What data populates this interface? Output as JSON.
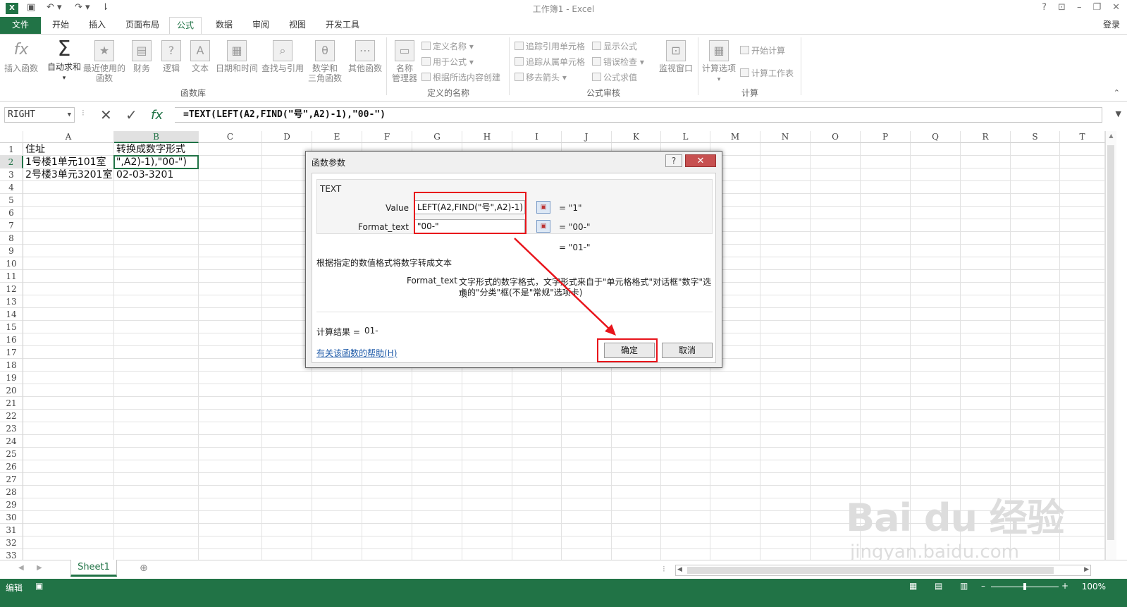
{
  "window": {
    "title": "工作簿1 - Excel",
    "help": "?",
    "login": "登录"
  },
  "tabs": [
    {
      "label": "文件"
    },
    {
      "label": "开始"
    },
    {
      "label": "插入"
    },
    {
      "label": "页面布局"
    },
    {
      "label": "公式"
    },
    {
      "label": "数据"
    },
    {
      "label": "审阅"
    },
    {
      "label": "视图"
    },
    {
      "label": "开发工具"
    }
  ],
  "ribbon": {
    "insert_function": "插入函数",
    "autosum": "自动求和",
    "recent1": "最近使用的",
    "recent2": "函数",
    "financial": "财务",
    "logical": "逻辑",
    "text": "文本",
    "datetime": "日期和时间",
    "lookup": "查找与引用",
    "math1": "数学和",
    "math2": "三角函数",
    "more": "其他函数",
    "group_library": "函数库",
    "name_mgr1": "名称",
    "name_mgr2": "管理器",
    "define_name": "定义名称",
    "use_in_formula": "用于公式",
    "create_from_sel": "根据所选内容创建",
    "group_names": "定义的名称",
    "trace_precedents": "追踪引用单元格",
    "trace_dependents": "追踪从属单元格",
    "remove_arrows": "移去箭头",
    "show_formulas": "显示公式",
    "error_checking": "错误检查",
    "evaluate": "公式求值",
    "watch_window": "监视窗口",
    "group_audit": "公式审核",
    "calc_options": "计算选项",
    "calc_now": "开始计算",
    "calc_sheet": "计算工作表",
    "group_calc": "计算"
  },
  "formula_bar": {
    "name_box": "RIGHT",
    "formula": "=TEXT(LEFT(A2,FIND(\"号\",A2)-1),\"00-\")"
  },
  "columns": [
    "A",
    "B",
    "C",
    "D",
    "E",
    "F",
    "G",
    "H",
    "I",
    "J",
    "K",
    "L",
    "M",
    "N",
    "O",
    "P",
    "Q",
    "R",
    "S",
    "T"
  ],
  "rows": [
    "1",
    "2",
    "3",
    "4",
    "5",
    "6",
    "7",
    "8",
    "9",
    "10",
    "11",
    "12",
    "13",
    "14",
    "15",
    "16",
    "17",
    "18",
    "19",
    "20",
    "21",
    "22",
    "23",
    "24",
    "25",
    "26",
    "27",
    "28",
    "29",
    "30",
    "31",
    "32",
    "33"
  ],
  "cells": {
    "A1": "住址",
    "B1": "转换成数字形式",
    "A2": "1号楼1单元101室",
    "B2": "\",A2)-1),\"00-\")",
    "A3": "2号楼3单元3201室",
    "B3": "02-03-3201"
  },
  "dialog": {
    "title": "函数参数",
    "function_name": "TEXT",
    "value_label": "Value",
    "value_input": "LEFT(A2,FIND(\"号\",A2)-1)",
    "value_result": "= \"1\"",
    "format_label": "Format_text",
    "format_input": "\"00-\"",
    "format_result": "= \"00-\"",
    "overall_result": "= \"01-\"",
    "description": "根据指定的数值格式将数字转成文本",
    "param_name": "Format_text",
    "param_desc1": "文字形式的数字格式，文字形式来自于\"单元格格式\"对话框\"数字\"选项",
    "param_desc2": "卡的\"分类\"框(不是\"常规\"选项卡)",
    "calc_result_label": "计算结果 =",
    "calc_result_value": "01-",
    "help_link": "有关该函数的帮助(H)",
    "ok": "确定",
    "cancel": "取消",
    "close": "✕"
  },
  "sheet_tab": "Sheet1",
  "status": {
    "mode": "编辑",
    "zoom": "100%"
  },
  "watermark": {
    "line1": "Bai du 经验",
    "line2": "jingyan.baidu.com"
  },
  "colors": {
    "accent": "#217346",
    "highlight": "#e8141b"
  }
}
